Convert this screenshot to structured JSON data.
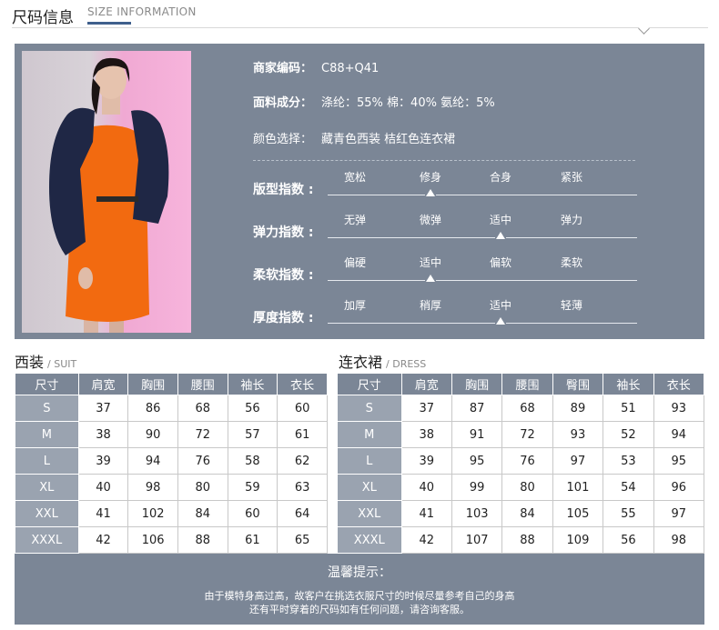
{
  "header": {
    "title_cn": "尺码信息",
    "title_en": "SIZE INFORMATION"
  },
  "product": {
    "code_label": "商家编码：",
    "code_value": "C88+Q41",
    "fabric_label": "面料成分：",
    "fabric_value": "涤纶：55% 棉：40% 氨纶：5%",
    "color_label": "颜色选择：",
    "color_value": "藏青色西装 桔红色连衣裙"
  },
  "indices": [
    {
      "label": "版型指数 :",
      "options": [
        "宽松",
        "修身",
        "合身",
        "紧张"
      ],
      "selected_index": 1
    },
    {
      "label": "弹力指数 :",
      "options": [
        "无弹",
        "微弹",
        "适中",
        "弹力"
      ],
      "selected_index": 2
    },
    {
      "label": "柔软指数 :",
      "options": [
        "偏硬",
        "适中",
        "偏软",
        "柔软"
      ],
      "selected_index": 1
    },
    {
      "label": "厚度指数 :",
      "options": [
        "加厚",
        "稍厚",
        "适中",
        "轻薄"
      ],
      "selected_index": 2
    }
  ],
  "suit": {
    "title_cn": "西装",
    "title_en": "/ SUIT",
    "headers": [
      "尺寸",
      "肩宽",
      "胸围",
      "腰围",
      "袖长",
      "衣长"
    ],
    "rows": [
      [
        "S",
        "37",
        "86",
        "68",
        "56",
        "60"
      ],
      [
        "M",
        "38",
        "90",
        "72",
        "57",
        "61"
      ],
      [
        "L",
        "39",
        "94",
        "76",
        "58",
        "62"
      ],
      [
        "XL",
        "40",
        "98",
        "80",
        "59",
        "63"
      ],
      [
        "XXL",
        "41",
        "102",
        "84",
        "60",
        "64"
      ],
      [
        "XXXL",
        "42",
        "106",
        "88",
        "61",
        "65"
      ]
    ]
  },
  "dress": {
    "title_cn": "连衣裙",
    "title_en": "/ DRESS",
    "headers": [
      "尺寸",
      "肩宽",
      "胸围",
      "腰围",
      "臀围",
      "袖长",
      "衣长"
    ],
    "rows": [
      [
        "S",
        "37",
        "87",
        "68",
        "89",
        "51",
        "93"
      ],
      [
        "M",
        "38",
        "91",
        "72",
        "93",
        "52",
        "94"
      ],
      [
        "L",
        "39",
        "95",
        "76",
        "97",
        "53",
        "95"
      ],
      [
        "XL",
        "40",
        "99",
        "80",
        "101",
        "54",
        "96"
      ],
      [
        "XXL",
        "41",
        "103",
        "84",
        "105",
        "55",
        "97"
      ],
      [
        "XXXL",
        "42",
        "107",
        "88",
        "109",
        "56",
        "98"
      ]
    ]
  },
  "notice": {
    "title": "温馨提示：",
    "line1": "由于模特身高过高，故客户在挑选衣服尺寸的时候尽量参考自己的身高",
    "line2": "还有平时穿着的尺码如有任何问题，请咨询客服。"
  },
  "colors": {
    "panel": "#7b8696",
    "accent_blue": "#3f5f8c",
    "dress_orange": "#f26a10",
    "suit_navy": "#1f2745"
  }
}
